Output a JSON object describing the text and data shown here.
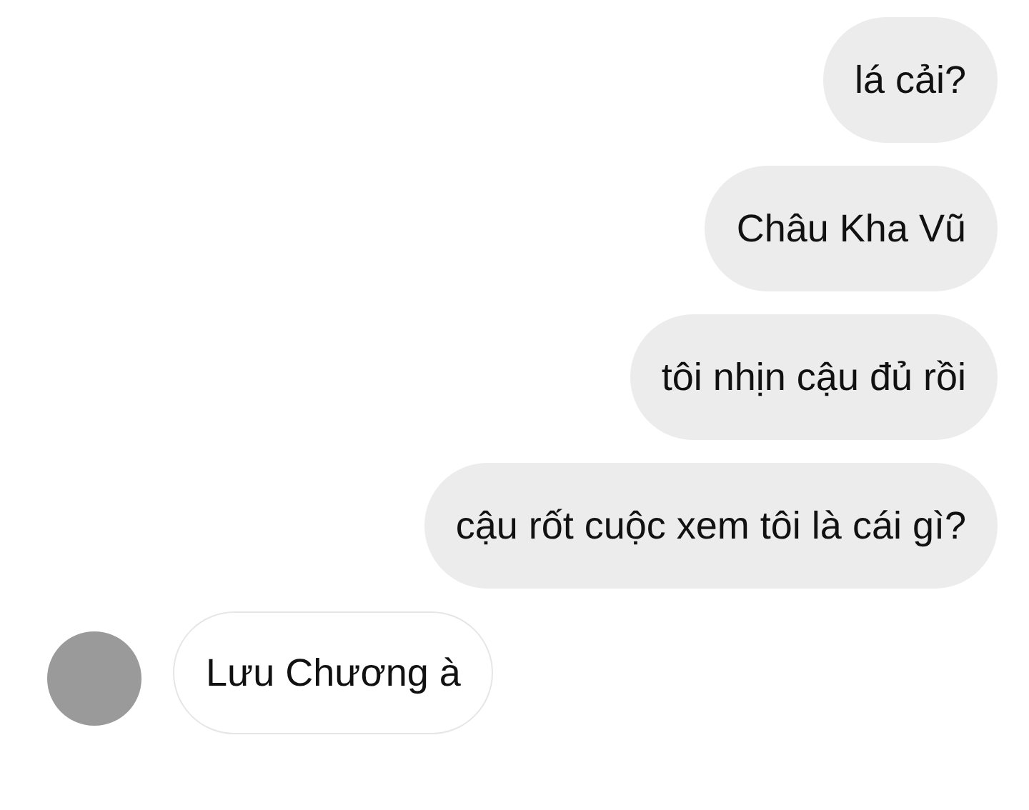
{
  "messages": [
    {
      "kind": "sent",
      "text": "lá cải?"
    },
    {
      "kind": "sent",
      "text": "Châu Kha Vũ"
    },
    {
      "kind": "sent",
      "text": "tôi nhịn cậu đủ rồi"
    },
    {
      "kind": "sent",
      "text": "cậu rốt cuộc xem tôi là cái gì?"
    },
    {
      "kind": "received",
      "text": "Lưu Chương à"
    }
  ]
}
